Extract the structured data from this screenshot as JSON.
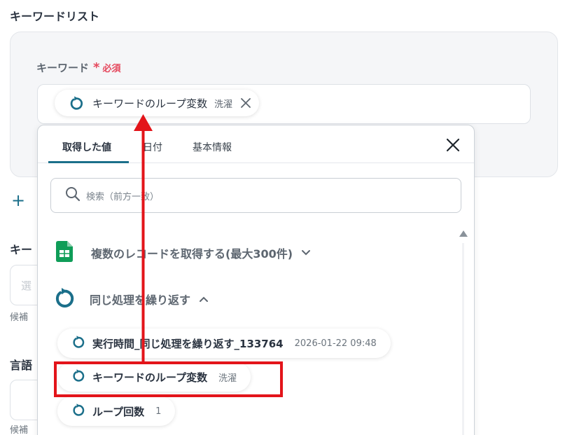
{
  "page": {
    "section_title": "キーワードリスト",
    "field_label": "キーワード",
    "required_star": "*",
    "required_text": "必須",
    "selected_chip": {
      "label": "キーワードのループ変数",
      "value": "洗濯"
    }
  },
  "background": {
    "keyword_label_partial": "キー",
    "select_placeholder_partial": "選",
    "help_text_1": "候補",
    "language_label": "言語",
    "help_text_2": "候補"
  },
  "popup": {
    "tabs": [
      {
        "label": "取得した値",
        "active": true
      },
      {
        "label": "日付",
        "active": false
      },
      {
        "label": "基本情報",
        "active": false
      }
    ],
    "search_placeholder": "検索（前方一致）",
    "groups": [
      {
        "label": "複数のレコードを取得する(最大300件)",
        "icon": "google-sheets-icon",
        "expanded": false
      },
      {
        "label": "同じ処理を繰り返す",
        "icon": "loop-icon",
        "expanded": true
      }
    ],
    "items": [
      {
        "label": "実行時間_同じ処理を繰り返す_133764",
        "value": "2026-01-22 09:48"
      },
      {
        "label": "キーワードのループ変数",
        "value": "洗濯"
      },
      {
        "label": "ループ回数",
        "value": "1"
      }
    ]
  },
  "colors": {
    "accent": "#1b6f8a",
    "required": "#e5485d",
    "annotation": "#e3141a",
    "sheets_green": "#0f9d58"
  }
}
